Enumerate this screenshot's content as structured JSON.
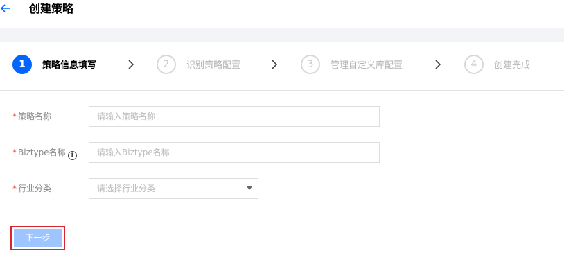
{
  "header": {
    "back_icon": "arrow-left-icon",
    "title": "创建策略"
  },
  "steps": [
    {
      "number": "1",
      "label": "策略信息填写",
      "state": "active"
    },
    {
      "number": "2",
      "label": "识别策略配置",
      "state": "inactive"
    },
    {
      "number": "3",
      "label": "管理自定义库配置",
      "state": "inactive"
    },
    {
      "number": "4",
      "label": "创建完成",
      "state": "inactive"
    }
  ],
  "form": {
    "required_mark": "*",
    "strategy_name": {
      "label": "策略名称",
      "placeholder": "请输入策略名称"
    },
    "biztype_name": {
      "label": "Biztype名称",
      "placeholder": "请输入Biztype名称",
      "info_icon": "info-icon"
    },
    "industry": {
      "label": "行业分类",
      "placeholder": "请选择行业分类"
    }
  },
  "actions": {
    "next_label": "下一步"
  },
  "colors": {
    "accent": "#0066ff",
    "required": "#e54545",
    "button_bg": "#9ec5ff",
    "highlight_border": "#d9262c"
  }
}
